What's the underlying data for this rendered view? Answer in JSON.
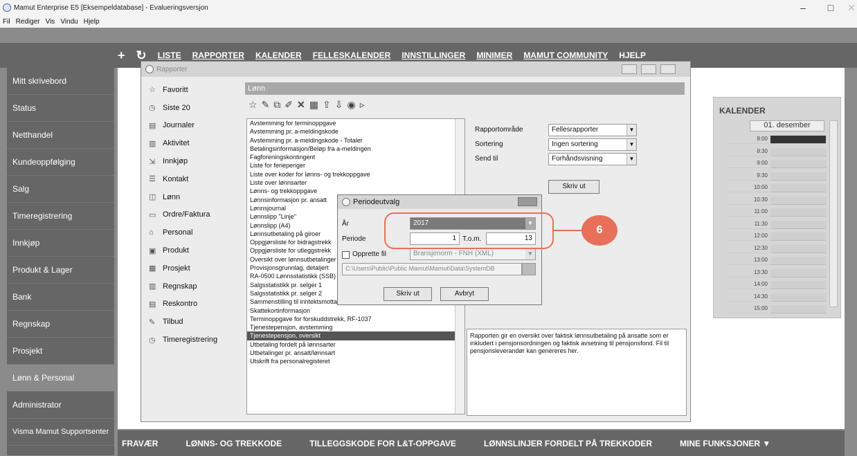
{
  "window": {
    "title": "Mamut Enterprise E5  [Eksempeldatabase]  - Evalueringsversjon",
    "minimize": "–",
    "restore": "□",
    "close": "✕"
  },
  "menubar": [
    "Fil",
    "Rediger",
    "Vis",
    "Vindu",
    "Hjelp"
  ],
  "topnav": {
    "plus": "+",
    "refresh": "↻",
    "items": [
      "LISTE",
      "RAPPORTER",
      "KALENDER",
      "FELLESKALENDER",
      "INNSTILLINGER",
      "MINIMER",
      "MAMUT COMMUNITY",
      "HJELP"
    ]
  },
  "sidebar": {
    "items": [
      "Mitt skrivebord",
      "Status",
      "Netthandel",
      "Kundeoppfølging",
      "Salg",
      "Timeregistrering",
      "Innkjøp",
      "Produkt & Lager",
      "Bank",
      "Regnskap",
      "Prosjekt",
      "Lønn & Personal",
      "Administrator",
      "Visma Mamut Supportsenter"
    ],
    "active_index": 11
  },
  "bottomnav": [
    "FRAVÆR",
    "LØNNS- OG TREKKODE",
    "TILLEGGSKODE FOR L&T-OPPGAVE",
    "LØNNSLINJER FORDELT PÅ TREKKODER",
    "MINE FUNKSJONER ▼"
  ],
  "calendar": {
    "title": "KALENDER",
    "day": "01. desember",
    "times": [
      "8:00",
      "8:30",
      "9:00",
      "9:30",
      "10:00",
      "10:30",
      "11:00",
      "11:30",
      "12:00",
      "12:30",
      "13:00",
      "13:30",
      "14:00",
      "14:30",
      "15:00"
    ]
  },
  "reports": {
    "title": "Rapporter",
    "categories": [
      "Favoritt",
      "Siste 20",
      "Journaler",
      "Aktivitet",
      "Innkjøp",
      "Kontakt",
      "Lønn",
      "Ordre/Faktura",
      "Personal",
      "Produkt",
      "Prosjekt",
      "Regnskap",
      "Reskontro",
      "Tilbud",
      "Timeregistrering"
    ],
    "section_title": "Lønn",
    "list": [
      "Avstemming for terminoppgave",
      "Avstemming pr. a-meldingskode",
      "Avstemming pr. a-meldingskode - Totaler",
      "Betalingsinformasjon/Beløp fra a-meldingen",
      "Fagforeningskontingent",
      "Liste for feriepenger",
      "Liste over koder for lønns- og trekkoppgave",
      "Liste over lønnsarter",
      "Lønns- og trekkoppgave",
      "Lønnsinformasjon pr. ansatt",
      "Lønnsjournal",
      "Lønnslipp \"Linje\"",
      "Lønnslipp (A4)",
      "Lønnsutbetaling på giroer",
      "Oppgjørsliste for bidragstrekk",
      "Oppgjørsliste for utleggstrekk",
      "Oversikt over lønnsutbetalinger",
      "Provisjonsgrunnlag, detaljert",
      "RA-0500 Lønnsstatistikk (SSB)",
      "Salgsstatistikk pr. selger 1",
      "Salgsstatistikk pr. selger 2",
      "Sammenstilling til inntektsmottaker fra opplysningspliktig",
      "Skattekortinformasjon",
      "Terminoppgave for forskuddstrekk,  RF-1037",
      "Tjenestepensjon, avstemming",
      "Tjenestepensjon, oversikt",
      "Utbetaling fordelt på lønnsarter",
      "Utbetalinger pr. ansatt/lønnsart",
      "Utskrift fra personalregisteret"
    ],
    "selected_index": 25,
    "fields": {
      "area_label": "Rapportområde",
      "area_value": "Fellesrapporter",
      "sort_label": "Sortering",
      "sort_value": "Ingen sortering",
      "send_label": "Send til",
      "send_value": "Forhåndsvisning"
    },
    "print_button": "Skriv ut",
    "description": "Rapporten gir en oversikt over faktisk lønnsutbetaling på ansatte som er inkludert i pensjonsordningen og faktisk avsetning til pensjonsfond. Fil til pensjonsleverandør kan genereres her."
  },
  "period": {
    "title": "Periodeutvalg",
    "year_label": "År",
    "year_value": "2017",
    "period_label": "Periode",
    "period_from": "1",
    "tom_label": "T.o.m.",
    "period_to": "13",
    "create_label": "Opprette fil",
    "create_value": "Bransjenorm - FNH (XML)",
    "path": "C:\\Users\\Public\\Public Mamut\\Mamut\\Data\\SystemDB",
    "print": "Skriv ut",
    "cancel": "Avbryt"
  },
  "callout": {
    "number": "6"
  },
  "colors": {
    "accent": "#e8705a",
    "sidebar": "#666666",
    "selected": "#555555"
  }
}
